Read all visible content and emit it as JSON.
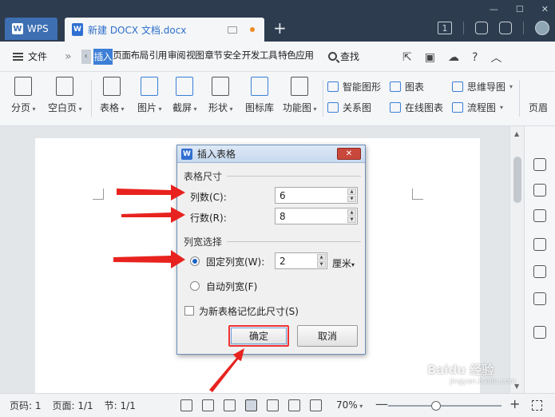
{
  "titlebar": {
    "wps_tab": "WPS",
    "doc_tab": "新建 DOCX 文档.docx",
    "new_tab": "+",
    "badge": "1"
  },
  "menubar": {
    "file": "文件",
    "items": [
      "插入",
      "页面布局",
      "引用",
      "审阅",
      "视图",
      "章节",
      "安全",
      "开发工具",
      "特色应用"
    ],
    "search": "查找"
  },
  "ribbon": {
    "buttons": [
      "分页",
      "空白页",
      "表格",
      "图片",
      "截屏",
      "形状",
      "图标库",
      "功能图"
    ],
    "small": [
      "智能图形",
      "图表",
      "思维导图",
      "关系图",
      "在线图表",
      "流程图"
    ],
    "cut_label": "页眉"
  },
  "dialog": {
    "title": "插入表格",
    "size_group": "表格尺寸",
    "cols_label": "列数(C):",
    "cols_value": "6",
    "rows_label": "行数(R):",
    "rows_value": "8",
    "width_group": "列宽选择",
    "fixed_label": "固定列宽(W):",
    "fixed_value": "2",
    "unit": "厘米",
    "auto_label": "自动列宽(F)",
    "remember_label": "为新表格记忆此尺寸(S)",
    "ok": "确定",
    "cancel": "取消"
  },
  "statusbar": {
    "page": "页码: 1",
    "pages": "页面: 1/1",
    "section": "节: 1/1",
    "zoom": "70%",
    "zoom_fraction": 0.42
  },
  "colors": {
    "accent": "#3d7fd6",
    "annotation_red": "#e8231f"
  },
  "watermark": {
    "text": "Baidu 经验",
    "sub": "jingyan.baidu.com"
  }
}
